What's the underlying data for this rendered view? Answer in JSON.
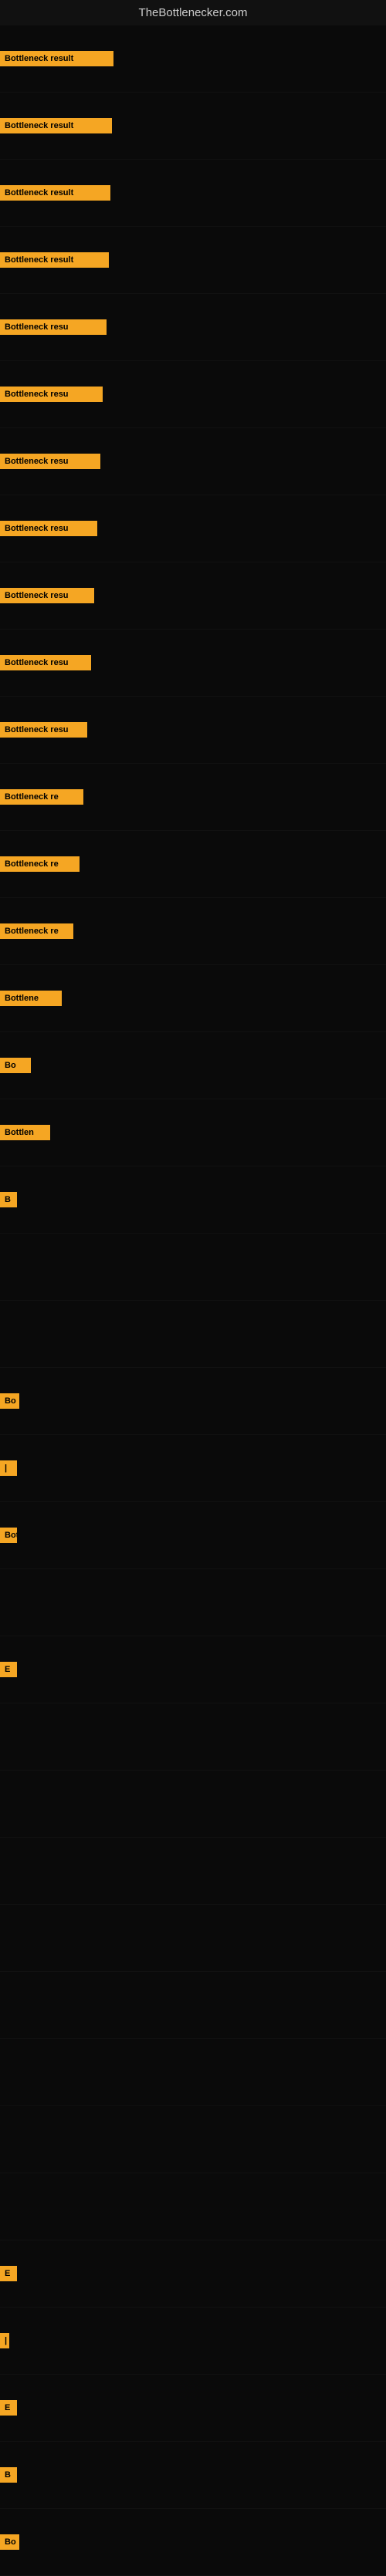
{
  "header": {
    "title": "TheBottlenecker.com"
  },
  "items": [
    {
      "label": "Bottleneck result",
      "badge_class": "badge-w1"
    },
    {
      "label": "Bottleneck result",
      "badge_class": "badge-w2"
    },
    {
      "label": "Bottleneck result",
      "badge_class": "badge-w3"
    },
    {
      "label": "Bottleneck result",
      "badge_class": "badge-w4"
    },
    {
      "label": "Bottleneck resu",
      "badge_class": "badge-w5"
    },
    {
      "label": "Bottleneck resu",
      "badge_class": "badge-w6"
    },
    {
      "label": "Bottleneck resu",
      "badge_class": "badge-w7"
    },
    {
      "label": "Bottleneck resu",
      "badge_class": "badge-w8"
    },
    {
      "label": "Bottleneck resu",
      "badge_class": "badge-w9"
    },
    {
      "label": "Bottleneck resu",
      "badge_class": "badge-w10"
    },
    {
      "label": "Bottleneck resu",
      "badge_class": "badge-w11"
    },
    {
      "label": "Bottleneck re",
      "badge_class": "badge-w12"
    },
    {
      "label": "Bottleneck re",
      "badge_class": "badge-w13"
    },
    {
      "label": "Bottleneck re",
      "badge_class": "badge-w14"
    },
    {
      "label": "Bottlene",
      "badge_class": "badge-w15"
    },
    {
      "label": "Bo",
      "badge_class": "badge-w16"
    },
    {
      "label": "Bottlen",
      "badge_class": "badge-w17"
    },
    {
      "label": "B",
      "badge_class": "badge-w18"
    },
    {
      "label": "",
      "badge_class": "badge-w22"
    },
    {
      "label": "",
      "badge_class": "badge-w22"
    },
    {
      "label": "Bo",
      "badge_class": "badge-w19"
    },
    {
      "label": "|",
      "badge_class": "badge-w20"
    },
    {
      "label": "Bott",
      "badge_class": "badge-w21"
    },
    {
      "label": "",
      "badge_class": "badge-w22"
    },
    {
      "label": "E",
      "badge_class": "badge-w30"
    },
    {
      "label": "",
      "badge_class": "badge-w22"
    },
    {
      "label": "",
      "badge_class": "badge-w22"
    },
    {
      "label": "",
      "badge_class": "badge-w22"
    },
    {
      "label": "",
      "badge_class": "badge-w22"
    },
    {
      "label": "",
      "badge_class": "badge-w22"
    },
    {
      "label": "",
      "badge_class": "badge-w22"
    },
    {
      "label": "",
      "badge_class": "badge-w22"
    },
    {
      "label": "",
      "badge_class": "badge-w22"
    },
    {
      "label": "E",
      "badge_class": "badge-w30"
    },
    {
      "label": "|",
      "badge_class": "badge-w31"
    },
    {
      "label": "E",
      "badge_class": "badge-w32"
    },
    {
      "label": "B",
      "badge_class": "badge-w33"
    },
    {
      "label": "Bo",
      "badge_class": "badge-w36"
    }
  ]
}
